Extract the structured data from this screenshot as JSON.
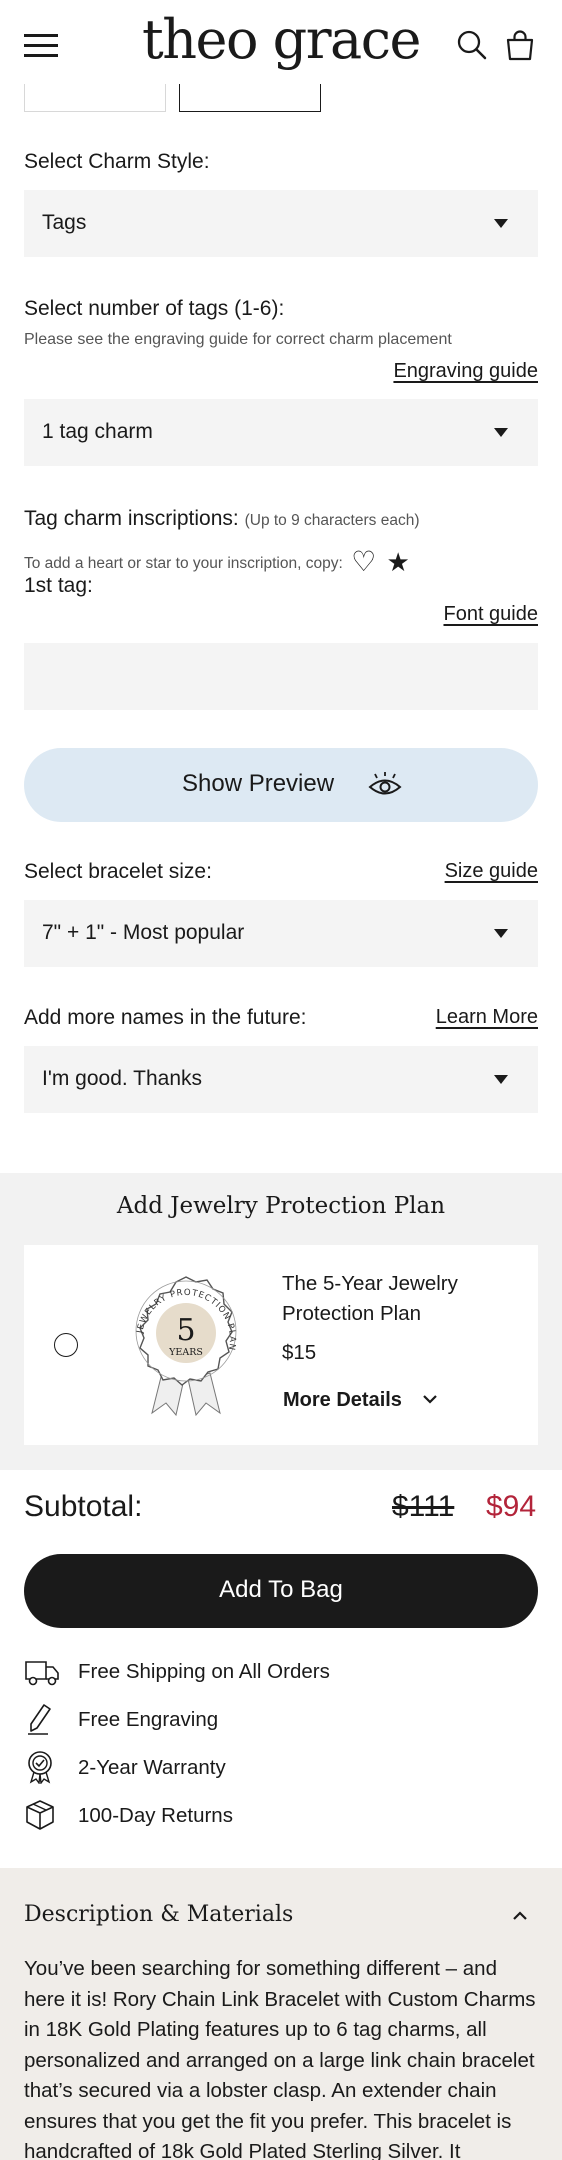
{
  "header": {
    "logo": "theo grace",
    "menu_icon": "hamburger-menu-icon",
    "search_icon": "search-icon",
    "bag_icon": "shopping-bag-icon"
  },
  "charm_style": {
    "label": "Select Charm Style:",
    "value": "Tags"
  },
  "tag_count": {
    "label": "Select number of tags (1-6):",
    "note": "Please see the engraving guide for correct charm placement",
    "guide_link": "Engraving guide",
    "value": "1 tag charm"
  },
  "inscriptions": {
    "label": "Tag charm inscriptions:",
    "label_note": "(Up to 9 characters each)",
    "copy_note": "To add a heart or star to your inscription, copy:",
    "heart_symbol": "♡",
    "star_symbol": "★",
    "first_tag_label": "1st tag:",
    "font_guide_link": "Font guide",
    "first_tag_value": ""
  },
  "preview": {
    "label": "Show Preview",
    "icon": "eye-icon"
  },
  "bracelet_size": {
    "label": "Select bracelet size:",
    "guide_link": "Size guide",
    "value": "7\" + 1\" - Most popular"
  },
  "future_names": {
    "label": "Add more names in the future:",
    "learn_link": "Learn More",
    "value": "I'm good. Thanks"
  },
  "protection": {
    "title": "Add Jewelry Protection Plan",
    "badge_number": "5",
    "badge_years": "YEARS",
    "badge_ring_text": "JEWELRY PROTECTION PLAN",
    "plan_name_line1": "The 5-Year Jewelry",
    "plan_name_line2": "Protection Plan",
    "price": "$15",
    "details_label": "More Details"
  },
  "subtotal": {
    "label": "Subtotal:",
    "original_price": "$111",
    "sale_price": "$94"
  },
  "add_to_bag": {
    "label": "Add To Bag"
  },
  "perks": [
    {
      "icon": "truck-icon",
      "label": "Free Shipping on All Orders"
    },
    {
      "icon": "pen-icon",
      "label": "Free Engraving"
    },
    {
      "icon": "award-ribbon-icon",
      "label": "2-Year Warranty"
    },
    {
      "icon": "box-icon",
      "label": "100-Day Returns"
    }
  ],
  "description": {
    "title": "Description & Materials",
    "lines": [
      "You’ve been searching for something different – and",
      "here it is! Rory Chain Link Bracelet with Custom Charms",
      "in 18K Gold Plating features up to 6 tag charms, all",
      "personalized and arranged on a large link chain bracelet",
      "that’s secured via a lobster clasp. An extender chain",
      "ensures that you get the fit you prefer. This bracelet is",
      "handcrafted of 18k Gold Plated Sterling Silver. It"
    ]
  },
  "colors": {
    "sale_red": "#b3243a",
    "preview_blue": "#dde9f3",
    "field_gray": "#f4f4f4",
    "description_bg": "#f0ede9",
    "badge_beige": "#e6dccb"
  }
}
